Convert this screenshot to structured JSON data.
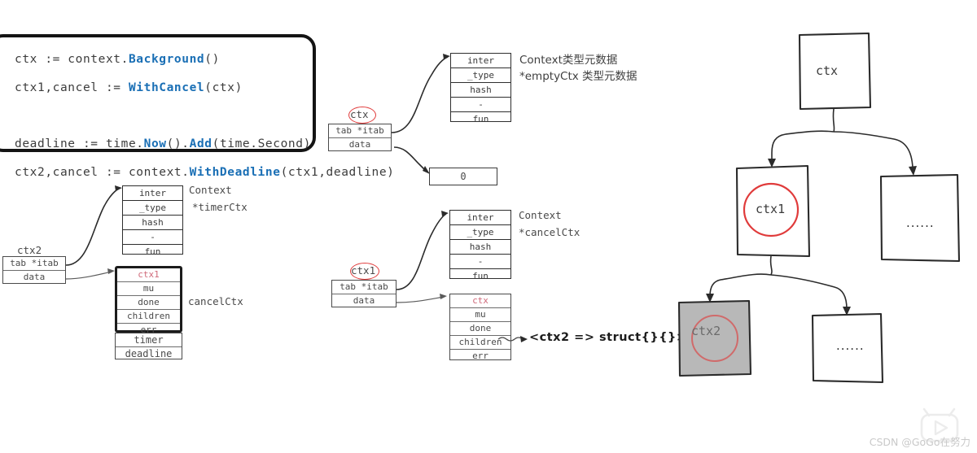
{
  "code_block": {
    "lines": [
      {
        "segments": [
          {
            "t": "ctx := context.",
            "k": false
          },
          {
            "t": "Background",
            "k": true
          },
          {
            "t": "()",
            "k": false
          }
        ]
      },
      {
        "segments": [
          {
            "t": "ctx1,cancel := ",
            "k": false
          },
          {
            "t": "WithCancel",
            "k": true
          },
          {
            "t": "(ctx)",
            "k": false
          }
        ]
      },
      {
        "segments": [
          {
            "t": "",
            "k": false
          }
        ]
      },
      {
        "segments": [
          {
            "t": "deadline := time.",
            "k": false
          },
          {
            "t": "Now",
            "k": true
          },
          {
            "t": "().",
            "k": false
          },
          {
            "t": "Add",
            "k": true
          },
          {
            "t": "(time.Second)",
            "k": false
          }
        ]
      },
      {
        "segments": [
          {
            "t": "ctx2,cancel := context.",
            "k": false
          },
          {
            "t": "WithDeadline",
            "k": true
          },
          {
            "t": "(ctx1,deadline)",
            "k": false
          }
        ]
      }
    ]
  },
  "diagram_ctx": {
    "var_label": "ctx",
    "iface_rows": [
      "tab *itab",
      "data"
    ],
    "itab_rows": [
      "inter",
      "_type",
      "hash",
      "-",
      "fun"
    ],
    "annotation_line1": "Context类型元数据",
    "annotation_line2": "*emptyCtx 类型元数据",
    "data_box_value": "0"
  },
  "diagram_ctx1": {
    "var_label": "ctx1",
    "iface_rows": [
      "tab *itab",
      "data"
    ],
    "itab_rows": [
      "inter",
      "_type",
      "hash",
      "-",
      "fun"
    ],
    "type_label_line1": "Context",
    "type_label_line2": "*cancelCtx",
    "struct_rows": [
      "ctx",
      "mu",
      "done",
      "children",
      "err"
    ],
    "children_annotation": "<ctx2 => struct{}{}>"
  },
  "diagram_ctx2": {
    "var_label": "ctx2",
    "iface_rows": [
      "tab *itab",
      "data"
    ],
    "itab_rows": [
      "inter",
      "_type",
      "hash",
      "-",
      "fun"
    ],
    "type_label_line1": "Context",
    "type_label_line2": "*timerCtx",
    "cancel_rows": [
      "ctx1",
      "mu",
      "done",
      "children",
      "err"
    ],
    "timer_rows": [
      "timer",
      "deadline"
    ],
    "struct_label": "cancelCtx"
  },
  "tree": {
    "root_label": "ctx",
    "child1_label": "ctx1",
    "child2_label": "......",
    "grandchild1_label": "ctx2",
    "grandchild2_label": "......"
  },
  "watermarks": {
    "csdn": "CSDN @GoGo在努力",
    "top": "",
    "play_icon": "play-triangle-icon"
  },
  "colors": {
    "keyword_blue": "#1a6fb5",
    "highlight_red": "#e03b3b",
    "row_red": "#d06a7a",
    "tree_stroke": "#2b2b2b",
    "ctx2_fill": "#b8b8b8"
  }
}
